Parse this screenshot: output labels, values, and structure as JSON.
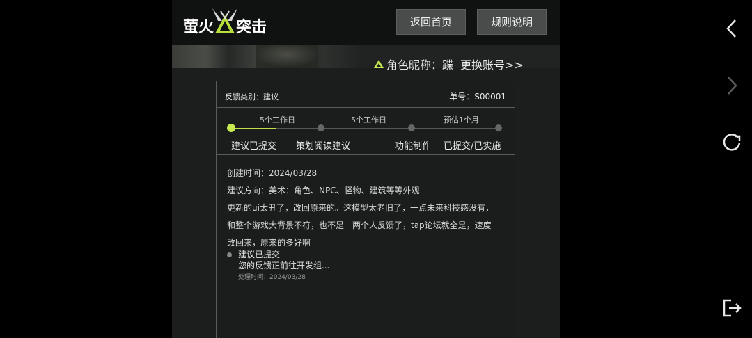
{
  "header": {
    "logo_left": "萤火",
    "logo_right": "突击",
    "home_button": "返回首页",
    "rules_button": "规则说明"
  },
  "profile": {
    "nickname_label": "角色昵称：",
    "nickname": "蹀",
    "change_account": "更换账号>>"
  },
  "ticket": {
    "category": "反馈类别：建议",
    "number": "单号：S00001",
    "durations": [
      "5个工作日",
      "5个工作日",
      "预估1个月"
    ],
    "steps": [
      "建议已提交",
      "策划阅读建议",
      "功能制作",
      "已提交/已实施"
    ],
    "progress_fraction": 0.17,
    "created": "创建时间：2024/03/28",
    "direction": "建议方向：美术：角色、NPC、怪物、建筑等等外观",
    "content_line1": "更新的ui太丑了，改回原来的。这模型太老旧了，一点未来科技感没有，",
    "content_line2": "和整个游戏大背景不符，也不是一两个人反馈了，tap论坛就全是，速度",
    "content_line3": "改回来，原来的多好啊",
    "log_title": "建议已提交",
    "log_desc": "您的反馈正前往开发组...",
    "log_time": "处理时间：2024/03/28"
  },
  "colors": {
    "accent": "#c8ea4f",
    "button_bg": "#4a4c4c",
    "panel_bg": "#1c1e1d"
  },
  "side_nav": {
    "icons": [
      "chevron-left-icon",
      "chevron-right-icon",
      "refresh-icon",
      "exit-icon"
    ]
  }
}
